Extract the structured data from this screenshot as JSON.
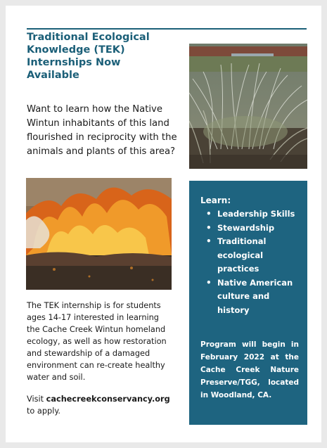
{
  "flyer": {
    "title": "Traditional Ecological Knowledge (TEK) Internships Now Available",
    "intro": "Want to learn how the Native Wintun inhabitants of this land flourished in reciprocity with the animals and plants of this area?",
    "learn_heading": "Learn:",
    "learn_items": [
      "Leadership Skills",
      "Stewardship",
      "Traditional ecological practices",
      "Native American culture and history"
    ],
    "program_note": "Program will begin in February 2022 at the Cache Creek Nature Preserve/TGG, located in Woodland, CA.",
    "description": "The TEK internship is for students ages 14-17 interested in learning the Cache Creek Wintun homeland ecology, as well as how restoration and stewardship of a damaged environment can re-create healthy water and soil.",
    "visit_prefix": "Visit ",
    "visit_link": "cachecreekconservancy.org",
    "visit_suffix": "to apply."
  },
  "colors": {
    "accent": "#1b5f78",
    "box": "#1e6480"
  }
}
